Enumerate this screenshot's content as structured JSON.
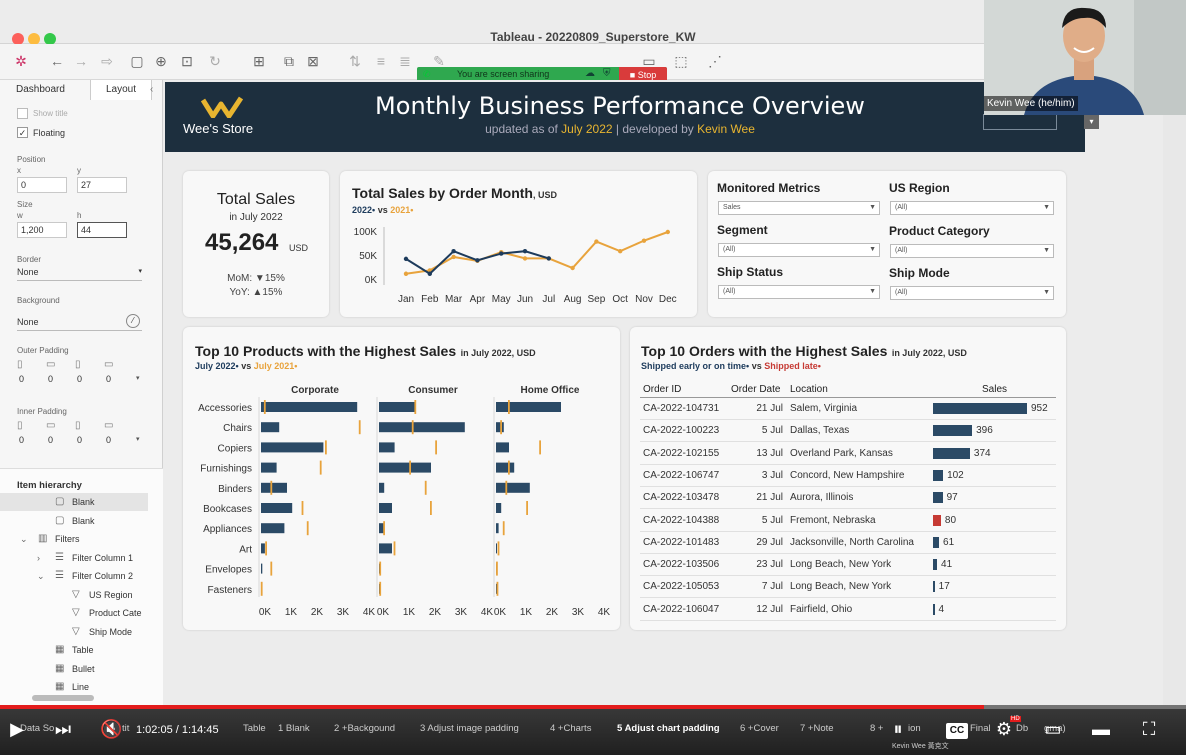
{
  "window": {
    "title": "Tableau - 20220809_Superstore_KW"
  },
  "screen_share": {
    "status": "You are screen sharing",
    "stop_label": "Stop Share"
  },
  "left_pane": {
    "tabs": [
      "Dashboard",
      "Layout"
    ],
    "show_title": "Show title",
    "floating": "Floating",
    "position_label": "Position",
    "x_label": "x",
    "x_value": "0",
    "y_label": "y",
    "y_value": "27",
    "size_label": "Size",
    "w_label": "w",
    "w_value": "1,200",
    "h_label": "h",
    "h_value": "44",
    "border_label": "Border",
    "border_value": "None",
    "background_label": "Background",
    "background_value": "None",
    "outer_padding_label": "Outer Padding",
    "outer_padding_values": [
      "0",
      "0",
      "0",
      "0"
    ],
    "inner_padding_label": "Inner Padding",
    "inner_padding_values": [
      "0",
      "0",
      "0",
      "0"
    ],
    "hierarchy_label": "Item hierarchy",
    "hierarchy": [
      "Blank",
      "Blank",
      "Filters",
      "Filter Column 1",
      "Filter Column 2",
      "US Region",
      "Product Cate",
      "Ship Mode",
      "Table",
      "Bullet",
      "Line"
    ]
  },
  "header": {
    "logo_text": "Wee's Store",
    "title": "Monthly Business Performance Overview",
    "updated_prefix": "updated as of",
    "updated_value": "July 2022",
    "dev_prefix": "developed by",
    "dev_value": "Kevin Wee"
  },
  "kpi": {
    "title": "Total Sales",
    "period": "in July 2022",
    "value": "45,264",
    "unit": "USD",
    "mom": "MoM: ▼15%",
    "yoy": "YoY: ▲15%"
  },
  "line_chart": {
    "title": "Total Sales by Order Month",
    "title_unit": ", USD",
    "legend_2022": "2022•",
    "legend_vs": "vs",
    "legend_2021": "2021•"
  },
  "filters": {
    "monitored_metrics_label": "Monitored Metrics",
    "monitored_metrics_value": "Sales",
    "us_region_label": "US Region",
    "us_region_value": "(All)",
    "segment_label": "Segment",
    "segment_value": "(All)",
    "product_category_label": "Product Category",
    "product_category_value": "(All)",
    "ship_status_label": "Ship Status",
    "ship_status_value": "(All)",
    "ship_mode_label": "Ship Mode",
    "ship_mode_value": "(All)"
  },
  "products": {
    "title": "Top 10 Products with the Highest Sales",
    "title_suffix": "in July 2022, USD",
    "legend_2022": "July 2022•",
    "legend_vs": "vs",
    "legend_2021": "July 2021•"
  },
  "orders": {
    "title": "Top 10 Orders with the Highest Sales",
    "title_suffix": "in July 2022, USD",
    "legend_ok": "Shipped early or on time•",
    "legend_vs": "vs",
    "legend_late": "Shipped late•",
    "col_id": "Order ID",
    "col_date": "Order Date",
    "col_loc": "Location",
    "col_sales": "Sales",
    "rows": [
      {
        "id": "CA-2022-104731",
        "date": "21 Jul",
        "loc": "Salem, Virginia",
        "sales": 952,
        "late": false
      },
      {
        "id": "CA-2022-100223",
        "date": "5 Jul",
        "loc": "Dallas, Texas",
        "sales": 396,
        "late": false
      },
      {
        "id": "CA-2022-102155",
        "date": "13 Jul",
        "loc": "Overland Park, Kansas",
        "sales": 374,
        "late": false
      },
      {
        "id": "CA-2022-106747",
        "date": "3 Jul",
        "loc": "Concord, New Hampshire",
        "sales": 102,
        "late": false
      },
      {
        "id": "CA-2022-103478",
        "date": "21 Jul",
        "loc": "Aurora, Illinois",
        "sales": 97,
        "late": false
      },
      {
        "id": "CA-2022-104388",
        "date": "5 Jul",
        "loc": "Fremont, Nebraska",
        "sales": 80,
        "late": true
      },
      {
        "id": "CA-2022-101483",
        "date": "29 Jul",
        "loc": "Jacksonville, North Carolina",
        "sales": 61,
        "late": false
      },
      {
        "id": "CA-2022-103506",
        "date": "23 Jul",
        "loc": "Long Beach, New York",
        "sales": 41,
        "late": false
      },
      {
        "id": "CA-2022-105053",
        "date": "7 Jul",
        "loc": "Long Beach, New York",
        "sales": 17,
        "late": false
      },
      {
        "id": "CA-2022-106047",
        "date": "12 Jul",
        "loc": "Fairfield, Ohio",
        "sales": 4,
        "late": false
      }
    ]
  },
  "webcam": {
    "name": "Kevin Wee (he/him)"
  },
  "video": {
    "time": "1:02:05 / 1:14:45",
    "progress_fraction": 0.83,
    "chapters": [
      "Data So",
      "tit",
      "Table",
      "1 Blank",
      "2 +Backgound",
      "3 Adjust image padding",
      "4 +Charts",
      "5 Adjust chart padding",
      "6 +Cover",
      "7 +Note",
      "8 +",
      "ion",
      "Final",
      "Db",
      "gma)"
    ],
    "user": "Kevin Wee 黃克文"
  },
  "colors": {
    "navy": "#1d3b5c",
    "orange": "#e8a33c",
    "red": "#c63a34",
    "header_bg": "#1d2f3e",
    "gold": "#e8b530"
  },
  "chart_data": [
    {
      "type": "line",
      "title": "Total Sales by Order Month",
      "ylabel": "",
      "categories": [
        "Jan",
        "Feb",
        "Mar",
        "Apr",
        "May",
        "Jun",
        "Jul",
        "Aug",
        "Sep",
        "Oct",
        "Nov",
        "Dec"
      ],
      "ytick_labels": [
        "100K",
        "50K",
        "0K"
      ],
      "ylim": [
        0,
        110000
      ],
      "series": [
        {
          "name": "2022",
          "color": "#1d3b5c",
          "values": [
            44000,
            13000,
            60000,
            41000,
            55000,
            60000,
            45000
          ]
        },
        {
          "name": "2021",
          "color": "#e8a33c",
          "values": [
            13000,
            20000,
            48000,
            40000,
            58000,
            45000,
            45000,
            25000,
            80000,
            60000,
            82000,
            100000
          ]
        }
      ],
      "grid": false
    },
    {
      "type": "bar",
      "title": "Top 10 Products with the Highest Sales",
      "orientation": "horizontal",
      "categories": [
        "Accessories",
        "Chairs",
        "Copiers",
        "Furnishings",
        "Binders",
        "Bookcases",
        "Appliances",
        "Art",
        "Envelopes",
        "Fasteners"
      ],
      "panels": [
        "Corporate",
        "Consumer",
        "Home Office"
      ],
      "xtick_labels": [
        "0K",
        "1K",
        "2K",
        "3K",
        "4K"
      ],
      "xlim": [
        0,
        4000
      ],
      "series": [
        {
          "name": "July 2022",
          "panel": "Corporate",
          "values": [
            3700,
            700,
            2400,
            600,
            1000,
            1200,
            900,
            150,
            50,
            30
          ]
        },
        {
          "name": "July 2021",
          "panel": "Corporate",
          "values": [
            150,
            3800,
            2500,
            2300,
            400,
            1600,
            1800,
            200,
            400,
            30
          ]
        },
        {
          "name": "July 2022",
          "panel": "Consumer",
          "values": [
            1400,
            3300,
            600,
            2000,
            200,
            500,
            200,
            500,
            30,
            30
          ]
        },
        {
          "name": "July 2021",
          "panel": "Consumer",
          "values": [
            1400,
            1300,
            2200,
            1200,
            1800,
            2000,
            200,
            600,
            50,
            50
          ]
        },
        {
          "name": "July 2022",
          "panel": "Home Office",
          "values": [
            2500,
            300,
            500,
            700,
            1300,
            200,
            100,
            30,
            30,
            30
          ]
        },
        {
          "name": "July 2021",
          "panel": "Home Office",
          "values": [
            500,
            200,
            1700,
            500,
            400,
            1200,
            300,
            100,
            40,
            60
          ]
        }
      ]
    },
    {
      "type": "bar",
      "title": "Top 10 Orders with the Highest Sales",
      "orientation": "horizontal",
      "categories": [
        "CA-2022-104731",
        "CA-2022-100223",
        "CA-2022-102155",
        "CA-2022-106747",
        "CA-2022-103478",
        "CA-2022-104388",
        "CA-2022-101483",
        "CA-2022-103506",
        "CA-2022-105053",
        "CA-2022-106047"
      ],
      "values": [
        952,
        396,
        374,
        102,
        97,
        80,
        61,
        41,
        17,
        4
      ],
      "xlim": [
        0,
        952
      ]
    }
  ]
}
